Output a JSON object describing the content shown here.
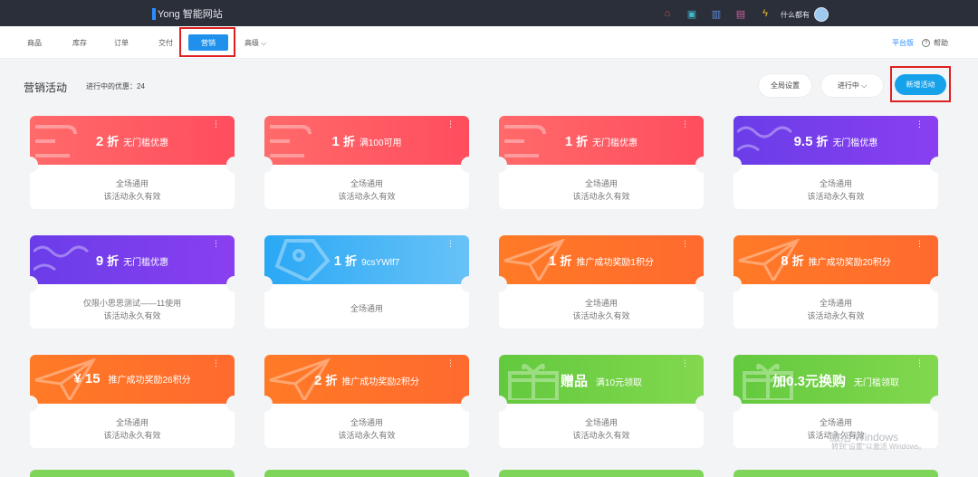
{
  "topbar": {
    "logo_text": "Yong 智能网站",
    "icons": [
      "home-icon",
      "store-icon",
      "building-icon",
      "calendar-icon",
      "lightning-icon"
    ],
    "user_name": "什么都有"
  },
  "nav": {
    "items": [
      "商品",
      "库存",
      "订单",
      "交付",
      "营销",
      "高级"
    ],
    "active": "营销",
    "platform": "平台版",
    "help": "帮助"
  },
  "header": {
    "title": "营销活动",
    "count_label": "进行中的优惠：24",
    "global_settings": "全局设置",
    "status_filter": "进行中",
    "new_activity": "新增活动"
  },
  "cards": [
    {
      "color": "red",
      "value": "2",
      "unit": "折",
      "desc": "无门槛优惠",
      "line1": "全场通用",
      "line2": "该活动永久有效"
    },
    {
      "color": "red",
      "value": "1",
      "unit": "折",
      "desc": "满100可用",
      "line1": "全场通用",
      "line2": "该活动永久有效"
    },
    {
      "color": "red",
      "value": "1",
      "unit": "折",
      "desc": "无门槛优惠",
      "line1": "全场通用",
      "line2": "该活动永久有效"
    },
    {
      "color": "purple",
      "value": "9.5",
      "unit": "折",
      "desc": "无门槛优惠",
      "line1": "全场通用",
      "line2": "该活动永久有效"
    },
    {
      "color": "purple",
      "value": "9",
      "unit": "折",
      "desc": "无门槛优惠",
      "line1": "仅限小思思测试——11使用",
      "line2": "该活动永久有效"
    },
    {
      "color": "blue",
      "value": "1",
      "unit": "折",
      "desc": "9csYWlf7",
      "line1": "全场通用",
      "line2": ""
    },
    {
      "color": "orange",
      "value": "1",
      "unit": "折",
      "desc": "推广成功奖励1积分",
      "line1": "全场通用",
      "line2": "该活动永久有效"
    },
    {
      "color": "orange",
      "value": "8",
      "unit": "折",
      "desc": "推广成功奖励20积分",
      "line1": "全场通用",
      "line2": "该活动永久有效"
    },
    {
      "color": "orange",
      "value": "¥ 15",
      "unit": "",
      "desc": "推广成功奖励26积分",
      "line1": "全场通用",
      "line2": "该活动永久有效"
    },
    {
      "color": "orange",
      "value": "2",
      "unit": "折",
      "desc": "推广成功奖励2积分",
      "line1": "全场通用",
      "line2": "该活动永久有效"
    },
    {
      "color": "green",
      "value": "赠品",
      "unit": "",
      "desc": "满10元领取",
      "line1": "全场通用",
      "line2": "该活动永久有效"
    },
    {
      "color": "green",
      "value": "加0.3元换购",
      "unit": "",
      "desc": "无门槛领取",
      "line1": "全场通用",
      "line2": "该活动永久有效"
    }
  ],
  "watermark": {
    "line1": "激活 Windows",
    "line2": "转到\"设置\"以激活 Windows。"
  }
}
